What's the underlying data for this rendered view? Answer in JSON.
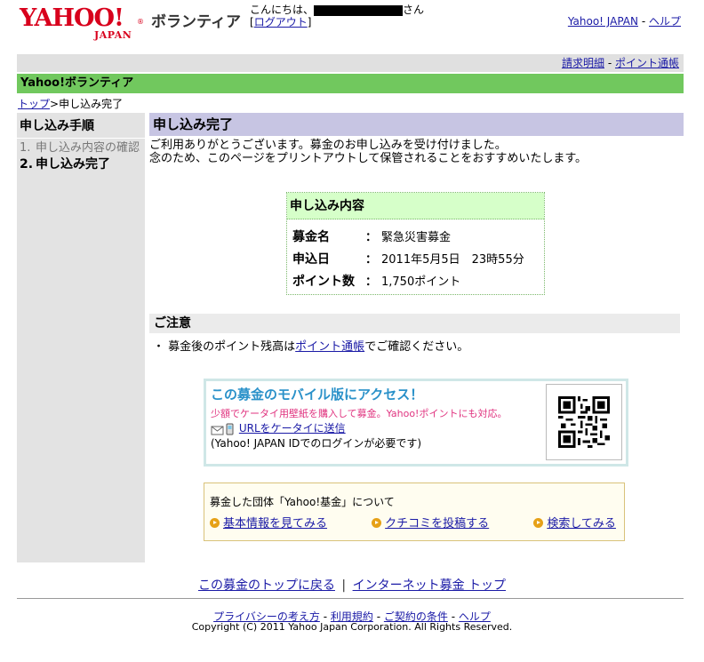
{
  "header": {
    "logo_text": "YAHOO!",
    "logo_sub": "JAPAN",
    "logo_reg": "®",
    "service_name": "ボランティア",
    "greeting_prefix": "こんにちは、",
    "greeting_suffix": "さん",
    "logout_open": "[",
    "logout_label": "ログアウト",
    "logout_close": "]",
    "top_link": "Yahoo! JAPAN",
    "help_link": "ヘルプ",
    "link_separator": "-"
  },
  "subbar": {
    "billing_link": "請求明細",
    "points_link": "ポイント通帳",
    "separator": "-"
  },
  "title_bar": "Yahoo!ボランティア",
  "breadcrumb": {
    "top_link": "トップ",
    "separator": ">",
    "current": "申し込み完了"
  },
  "sidebar": {
    "title": "申し込み手順",
    "steps": [
      {
        "num": "1.",
        "label": "申し込み内容の確認"
      },
      {
        "num": "2.",
        "label": "申し込み完了"
      }
    ]
  },
  "main": {
    "title": "申し込み完了",
    "thanks_line1": "ご利用ありがとうございます。募金のお申し込みを受け付けました。",
    "thanks_line2": "念のため、このページをプリントアウトして保管されることをおすすめいたします。"
  },
  "summary": {
    "heading": "申し込み内容",
    "colon": "：",
    "rows": [
      {
        "key": "募金名",
        "value": "緊急災害募金"
      },
      {
        "key": "申込日",
        "value": "2011年5月5日　23時55分"
      },
      {
        "key": "ポイント数",
        "value": "1,750ポイント"
      }
    ]
  },
  "notice": {
    "heading": "ご注意",
    "bullet": "・",
    "text_before": "募金後のポイント残高は",
    "link": "ポイント通帳",
    "text_after": "でご確認ください。"
  },
  "mobile": {
    "title": "この募金のモバイル版にアクセス！",
    "subtitle": "少額でケータイ用壁紙を購入して募金。Yahoo!ポイントにも対応。",
    "link": "URLをケータイに送信",
    "note": "(Yahoo! JAPAN IDでのログインが必要です)",
    "icons": [
      "mail-icon",
      "mobile-phone-icon",
      "qr-code-icon"
    ]
  },
  "org": {
    "title": "募金した団体「Yahoo!基金」について",
    "links": [
      "基本情報を見てみる",
      "クチコミを投稿する",
      "検索してみる"
    ]
  },
  "bottom_nav": {
    "fund_top": "この募金のトップに戻る",
    "separator": "|",
    "internet_top": "インターネット募金 トップ"
  },
  "footer": {
    "links": [
      "プライバシーの考え方",
      "利用規約",
      "ご契約の条件",
      "ヘルプ"
    ],
    "separator": "-",
    "copyright": "Copyright (C) 2011 Yahoo Japan Corporation. All Rights Reserved."
  },
  "colors": {
    "title_bar": "#71c85e",
    "main_title": "#c7c5e3",
    "summary_head": "#d6ffc9",
    "mobile_title": "#2a91c9",
    "mobile_subtitle": "#e0337f",
    "logo_red": "#d8001c",
    "bullet_orange": "#e6a117"
  }
}
